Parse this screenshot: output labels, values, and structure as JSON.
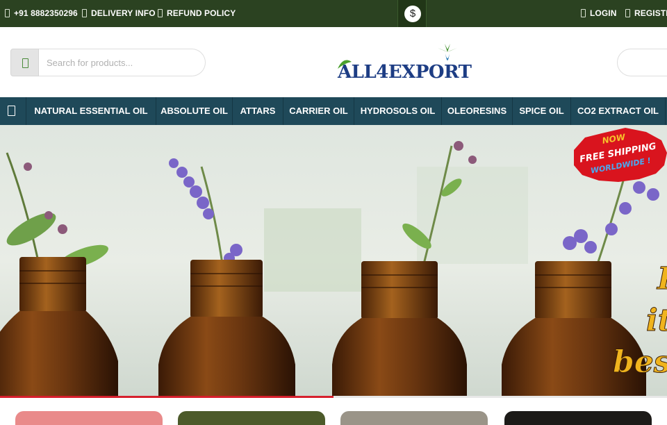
{
  "topbar": {
    "phone": "+91 8882350296",
    "delivery": "DELIVERY INFO",
    "refund": "REFUND POLICY",
    "currency_symbol": "$",
    "login": "LOGIN",
    "register": "REGISTE"
  },
  "search": {
    "placeholder": "Search for products..."
  },
  "logo": {
    "text": "ALL4EXPORT"
  },
  "nav": {
    "items": [
      "NATURAL ESSENTIAL OIL",
      "ABSOLUTE OIL",
      "ATTARS",
      "CARRIER OIL",
      "HYDROSOLS OIL",
      "OLEORESINS",
      "SPICE OIL",
      "CO2 EXTRACT OIL"
    ]
  },
  "hero": {
    "badge_line1": "NOW",
    "badge_line2": "FREE SHIPPING",
    "badge_line3": "WORLDWIDE !",
    "slogan_line1": "P",
    "slogan_line2": "it",
    "slogan_line3": "best p",
    "slide_progress": 0.5
  },
  "colors": {
    "topbar_bg": "#2b4221",
    "nav_bg": "#1f4959",
    "badge_red": "#d9141e",
    "progress_red": "#d61f2c",
    "logo_blue": "#1d3d84"
  },
  "icons": {
    "phone": "phone-icon",
    "delivery": "truck-icon",
    "refund": "refund-icon",
    "login": "user-icon",
    "register": "register-icon",
    "search": "search-icon",
    "home": "home-icon"
  }
}
